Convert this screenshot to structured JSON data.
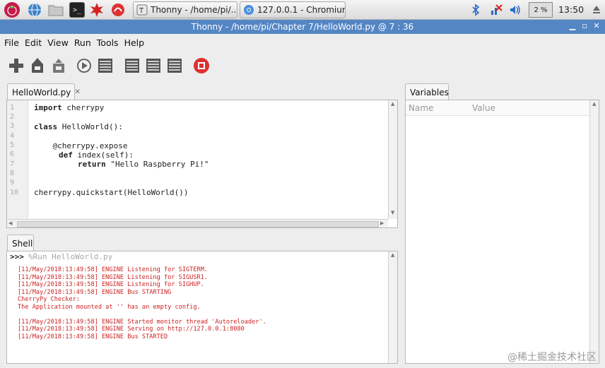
{
  "taskbar": {
    "tasks": [
      "Thonny - /home/pi/...",
      "127.0.0.1 - Chromium"
    ],
    "cpu": "2 %",
    "clock": "13:50"
  },
  "window": {
    "title": "Thonny  -  /home/pi/Chapter 7/HelloWorld.py  @  7 : 36"
  },
  "menu": [
    "File",
    "Edit",
    "View",
    "Run",
    "Tools",
    "Help"
  ],
  "editor": {
    "tab_label": "HelloWorld.py",
    "lines": [
      "1",
      "2",
      "3",
      "4",
      "5",
      "6",
      "7",
      "8",
      "9",
      "10"
    ],
    "code": {
      "l1_kw": "import",
      "l1_rest": " cherrypy",
      "l3_kw": "class",
      "l3_rest": " HelloWorld():",
      "l5": "    @cherrypy.expose",
      "l6_kw": "def",
      "l6_rest": " index(self):",
      "l7_kw": "return",
      "l7_rest": " \"Hello Raspberry Pi!\"",
      "l10": "cherrypy.quickstart(HelloWorld())"
    }
  },
  "shell": {
    "tab_label": "Shell",
    "prompt": ">>>",
    "command": "%Run HelloWorld.py",
    "output": [
      "[11/May/2018:13:49:58] ENGINE Listening for SIGTERM.",
      "[11/May/2018:13:49:58] ENGINE Listening for SIGUSR1.",
      "[11/May/2018:13:49:58] ENGINE Listening for SIGHUP.",
      "[11/May/2018:13:49:58] ENGINE Bus STARTING",
      "CherryPy Checker:",
      "The Application mounted at '' has an empty config.",
      "",
      "[11/May/2018:13:49:58] ENGINE Started monitor thread 'Autoreloader'.",
      "[11/May/2018:13:49:58] ENGINE Serving on http://127.0.0.1:8080",
      "[11/May/2018:13:49:58] ENGINE Bus STARTED"
    ]
  },
  "variables": {
    "tab_label": "Variables",
    "col_name": "Name",
    "col_value": "Value"
  },
  "watermark": "@稀土掘金技术社区",
  "colors": {
    "titlebar": "#5486c4",
    "shell_output": "#cc2222",
    "stop": "#e03030"
  }
}
